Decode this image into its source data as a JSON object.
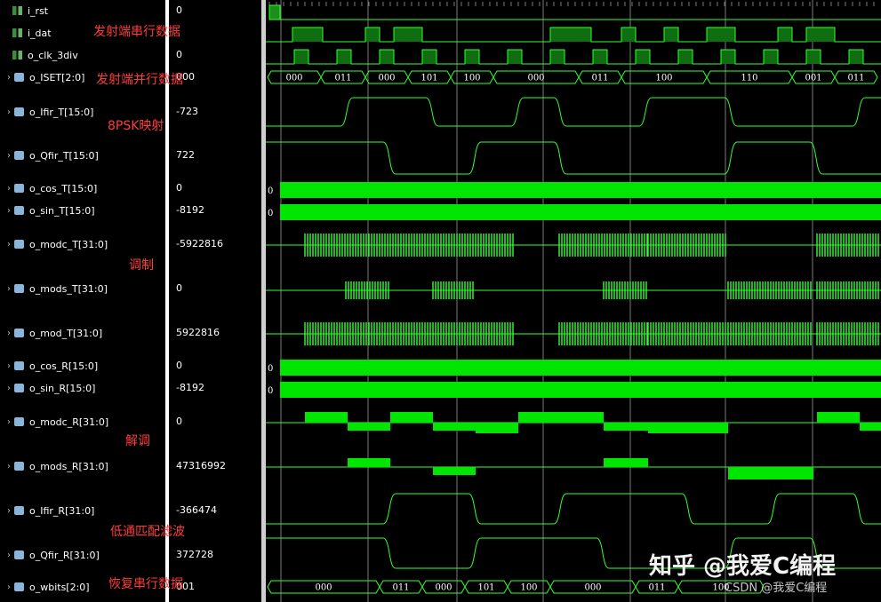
{
  "signals": [
    {
      "name": "i_rst",
      "value": "0",
      "kind": "bit"
    },
    {
      "name": "i_dat",
      "value": "",
      "kind": "bit"
    },
    {
      "name": "o_clk_3div",
      "value": "0",
      "kind": "bit"
    },
    {
      "name": "o_ISET[2:0]",
      "value": "000",
      "kind": "bus"
    },
    {
      "name": "o_Ifir_T[15:0]",
      "value": "-723",
      "kind": "bus"
    },
    {
      "name": "o_Qfir_T[15:0]",
      "value": "722",
      "kind": "bus"
    },
    {
      "name": "o_cos_T[15:0]",
      "value": "0",
      "kind": "bus"
    },
    {
      "name": "o_sin_T[15:0]",
      "value": "-8192",
      "kind": "bus"
    },
    {
      "name": "o_modc_T[31:0]",
      "value": "-5922816",
      "kind": "bus"
    },
    {
      "name": "o_mods_T[31:0]",
      "value": "0",
      "kind": "bus"
    },
    {
      "name": "o_mod_T[31:0]",
      "value": "5922816",
      "kind": "bus"
    },
    {
      "name": "o_cos_R[15:0]",
      "value": "0",
      "kind": "bus"
    },
    {
      "name": "o_sin_R[15:0]",
      "value": "-8192",
      "kind": "bus"
    },
    {
      "name": "o_modc_R[31:0]",
      "value": "0",
      "kind": "bus"
    },
    {
      "name": "o_mods_R[31:0]",
      "value": "47316992",
      "kind": "bus"
    },
    {
      "name": "o_Ifir_R[31:0]",
      "value": "-366474",
      "kind": "bus"
    },
    {
      "name": "o_Qfir_R[31:0]",
      "value": "372728",
      "kind": "bus"
    },
    {
      "name": "o_wbits[2:0]",
      "value": "001",
      "kind": "bus"
    }
  ],
  "annotations": [
    {
      "text": "发射端串行数据"
    },
    {
      "text": "发射端并行数据"
    },
    {
      "text": "8PSK映射"
    },
    {
      "text": "调制"
    },
    {
      "text": "解调"
    },
    {
      "text": "低通匹配滤波"
    },
    {
      "text": "恢复串行数据"
    }
  ],
  "watermark": {
    "main": "知乎 @我爱C编程",
    "sub": "CSDN @我爱C编程"
  },
  "iset_labels": [
    "000",
    "011",
    "000",
    "101",
    "100",
    "000",
    "011",
    "100",
    "110",
    "001",
    "011"
  ],
  "wbits_labels": [
    "000",
    "011",
    "000",
    "101",
    "100",
    "000",
    "011",
    "100"
  ],
  "colors": {
    "wave": "#33ff33",
    "bus_fill": "#00e600",
    "text": "#ffffff",
    "annot": "#ff3b3b"
  }
}
